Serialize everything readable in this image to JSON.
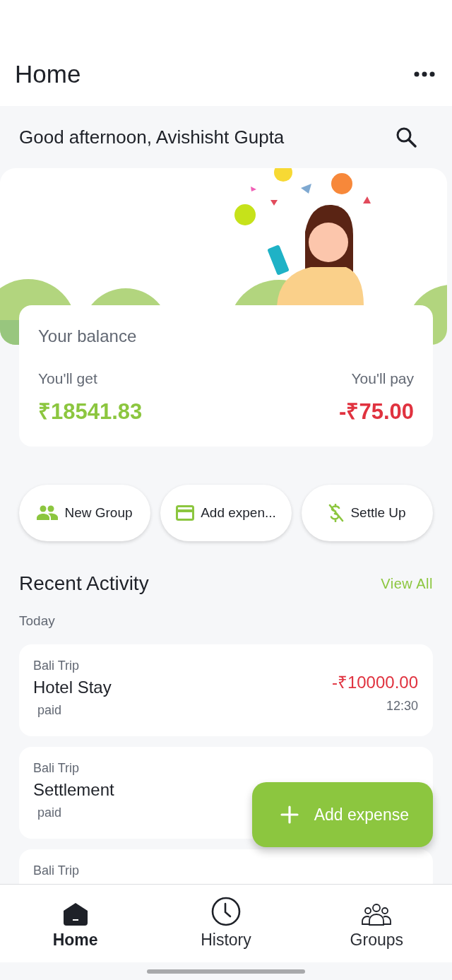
{
  "app_bar": {
    "title": "Home"
  },
  "greeting": "Good afternoon, Avishisht Gupta",
  "balance": {
    "title": "Your balance",
    "get_label": "You'll get",
    "get_amount": "₹18541.83",
    "pay_label": "You'll pay",
    "pay_amount": "-₹75.00"
  },
  "quick_actions": [
    {
      "label": "New Group"
    },
    {
      "label": "Add expen..."
    },
    {
      "label": "Settle Up"
    }
  ],
  "recent_activity": {
    "title": "Recent Activity",
    "link": "View All",
    "date": "Today",
    "items": [
      {
        "group": "Bali Trip",
        "title": "Hotel Stay",
        "status": "paid",
        "amount": "-₹10000.00",
        "time": "12:30"
      },
      {
        "group": "Bali Trip",
        "title": "Settlement",
        "status": "paid"
      },
      {
        "group": "Bali Trip"
      }
    ]
  },
  "fab": {
    "label": "Add expense"
  },
  "bottom_nav": [
    {
      "label": "Home",
      "selected": true
    },
    {
      "label": "History",
      "selected": false
    },
    {
      "label": "Groups",
      "selected": false
    }
  ]
}
